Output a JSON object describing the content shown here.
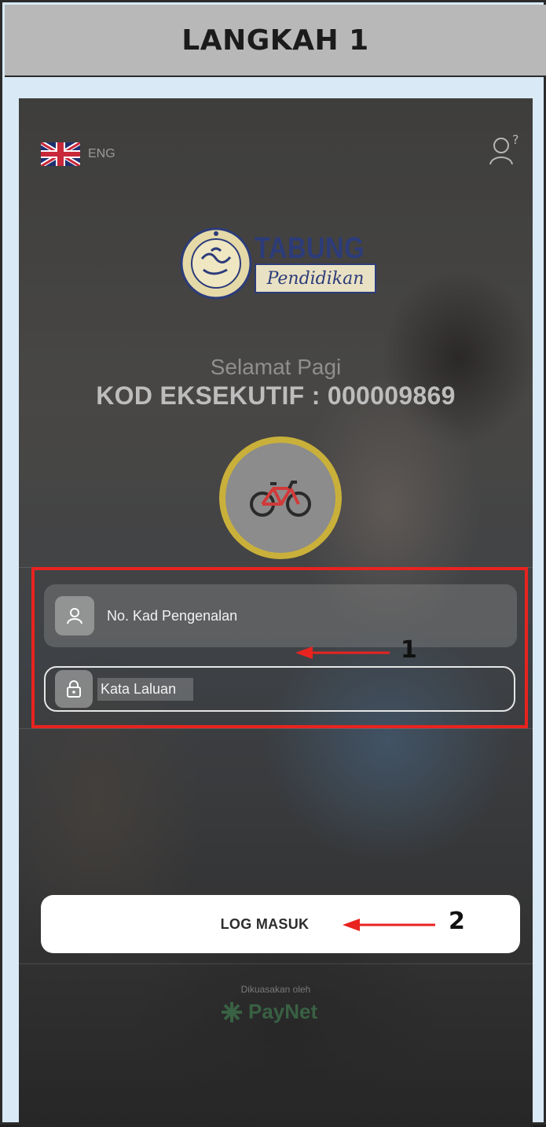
{
  "header": {
    "title": "LANGKAH 1"
  },
  "language": {
    "label": "ENG",
    "flag_icon": "uk-flag-icon"
  },
  "help_icon": "user-help-icon",
  "logo": {
    "name": "TABUNG",
    "subtitle": "Pendidikan"
  },
  "greeting": "Selamat Pagi",
  "executive_code": "KOD EKSEKUTIF : 000009869",
  "badge_icon": "bicycle-icon",
  "form": {
    "ic_placeholder": "No. Kad Pengenalan",
    "password_placeholder": "Kata Laluan"
  },
  "login_button": "LOG MASUK",
  "annotations": {
    "first": "1",
    "second": "2"
  },
  "footer": {
    "powered_by": "Dikuasakan oleh",
    "brand": "PayNet"
  },
  "colors": {
    "annotation_red": "#e8231f",
    "header_gray": "#b8b8b8",
    "background_blue": "#d9e9f5",
    "badge_gold": "#c9b03a"
  }
}
